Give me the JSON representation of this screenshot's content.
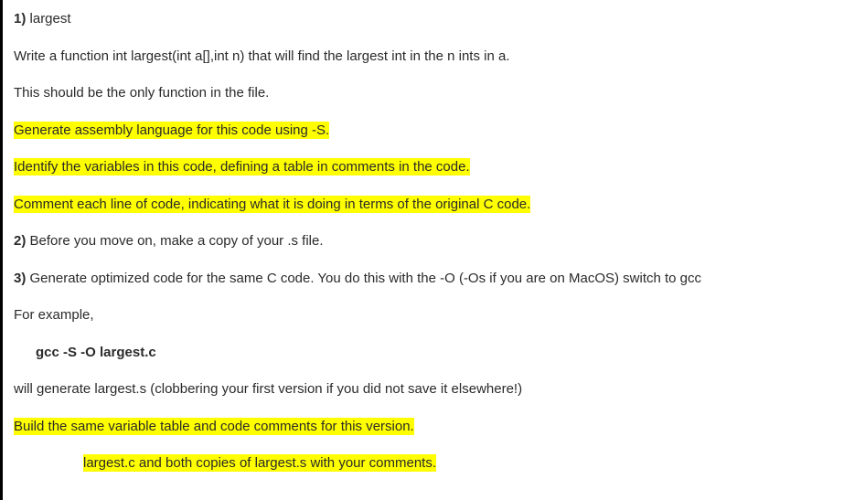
{
  "section1": {
    "heading": "1)",
    "title": "largest",
    "line1": "Write a function int largest(int a[],int n) that will find the largest int in the n ints in a.",
    "line2": "This should be the only function in the file.",
    "hl1": "Generate assembly language for this code using -S.",
    "hl2": "Identify the variables in this code, defining a table in comments in the code.",
    "hl3": "Comment each line of code, indicating what it is doing in terms of the original C code."
  },
  "section2": {
    "heading": "2)",
    "text": "Before you move on, make a copy of your .s file."
  },
  "section3": {
    "heading": "3)",
    "text": "Generate optimized code for the same C code. You do this with the -O (-Os if you are on MacOS) switch to gcc",
    "example_label": "For example,",
    "command": "gcc -S -O largest.c",
    "result": "will generate largest.s (clobbering your first version if you did not save it elsewhere!)",
    "hl4": "Build the same variable table and code comments for this version.",
    "hl5": "largest.c and both copies of largest.s with your comments."
  }
}
